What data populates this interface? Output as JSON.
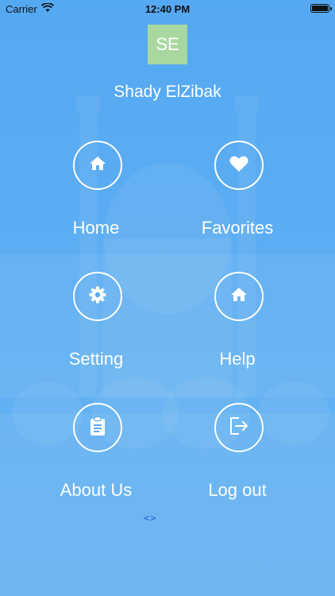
{
  "status_bar": {
    "carrier": "Carrier",
    "time": "12:40 PM"
  },
  "profile": {
    "initials": "SE",
    "name": "Shady ElZibak"
  },
  "menu": {
    "items": [
      {
        "label": "Home",
        "icon": "home-icon"
      },
      {
        "label": "Favorites",
        "icon": "heart-icon"
      },
      {
        "label": "Setting",
        "icon": "gear-icon"
      },
      {
        "label": "Help",
        "icon": "home-icon"
      },
      {
        "label": "About Us",
        "icon": "clipboard-icon"
      },
      {
        "label": "Log out",
        "icon": "logout-icon"
      }
    ]
  },
  "footer": {
    "code_link": "<>"
  },
  "colors": {
    "background": "#5aaaf0",
    "avatar": "#a8d8a0",
    "foreground": "#ffffff",
    "link": "#1e5fd8"
  }
}
